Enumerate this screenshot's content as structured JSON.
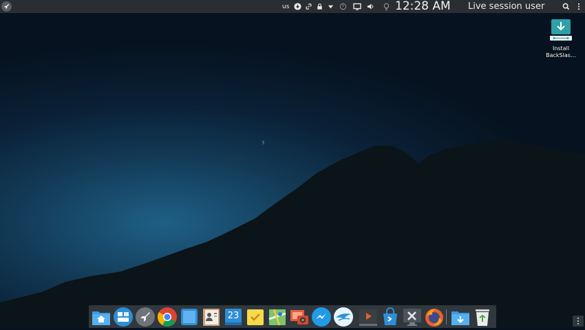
{
  "top_panel": {
    "keyboard_layout": "us",
    "clock": "12:28 AM",
    "session_user": "Live session user",
    "icons": [
      "launcher-icon",
      "update-icon",
      "link-icon",
      "lock-icon",
      "network-dropdown-icon",
      "power-icon",
      "display-icon",
      "volume-icon",
      "bulb-icon",
      "search-icon",
      "more-options-icon"
    ]
  },
  "desktop": {
    "icons": [
      {
        "label": "Install BackSlas…",
        "icon": "install-download-icon"
      }
    ]
  },
  "dock": {
    "items": [
      "home-folder-icon",
      "multitasking-view-icon",
      "launchpad-rocket-icon",
      "chrome-icon",
      "note-app-icon",
      "contacts-icon",
      "calendar-icon",
      "tasks-icon",
      "maps-icon",
      "photo-booth-icon",
      "messenger-icon",
      "mail-bird-icon",
      "video-player-icon",
      "app-store-icon",
      "system-settings-icon",
      "firefox-icon",
      "downloads-folder-icon",
      "trash-icon"
    ],
    "calendar_day": "23"
  },
  "colors": {
    "panel": "#2a2e32",
    "accent_blue": "#2d8fd6",
    "install_teal": "#2ea0a8"
  }
}
